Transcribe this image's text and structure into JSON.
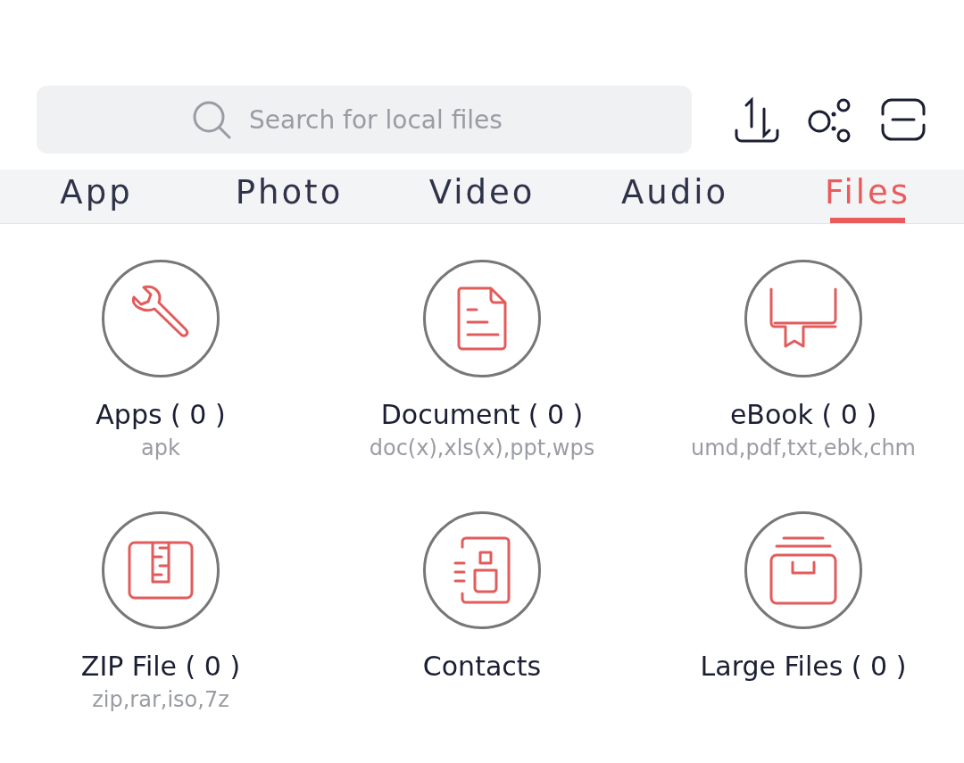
{
  "search": {
    "placeholder": "Search for local files"
  },
  "tabs": [
    {
      "label": "App",
      "selected": false
    },
    {
      "label": "Photo",
      "selected": false
    },
    {
      "label": "Video",
      "selected": false
    },
    {
      "label": "Audio",
      "selected": false
    },
    {
      "label": "Files",
      "selected": true
    }
  ],
  "categories": [
    {
      "kind": "apps",
      "title": "Apps ( 0 )",
      "subtitle": "apk"
    },
    {
      "kind": "document",
      "title": "Document ( 0 )",
      "subtitle": "doc(x),xls(x),ppt,wps"
    },
    {
      "kind": "ebook",
      "title": "eBook ( 0 )",
      "subtitle": "umd,pdf,txt,ebk,chm"
    },
    {
      "kind": "zip",
      "title": "ZIP File ( 0 )",
      "subtitle": "zip,rar,iso,7z"
    },
    {
      "kind": "contacts",
      "title": "Contacts"
    },
    {
      "kind": "large",
      "title": "Large Files ( 0 )"
    }
  ]
}
